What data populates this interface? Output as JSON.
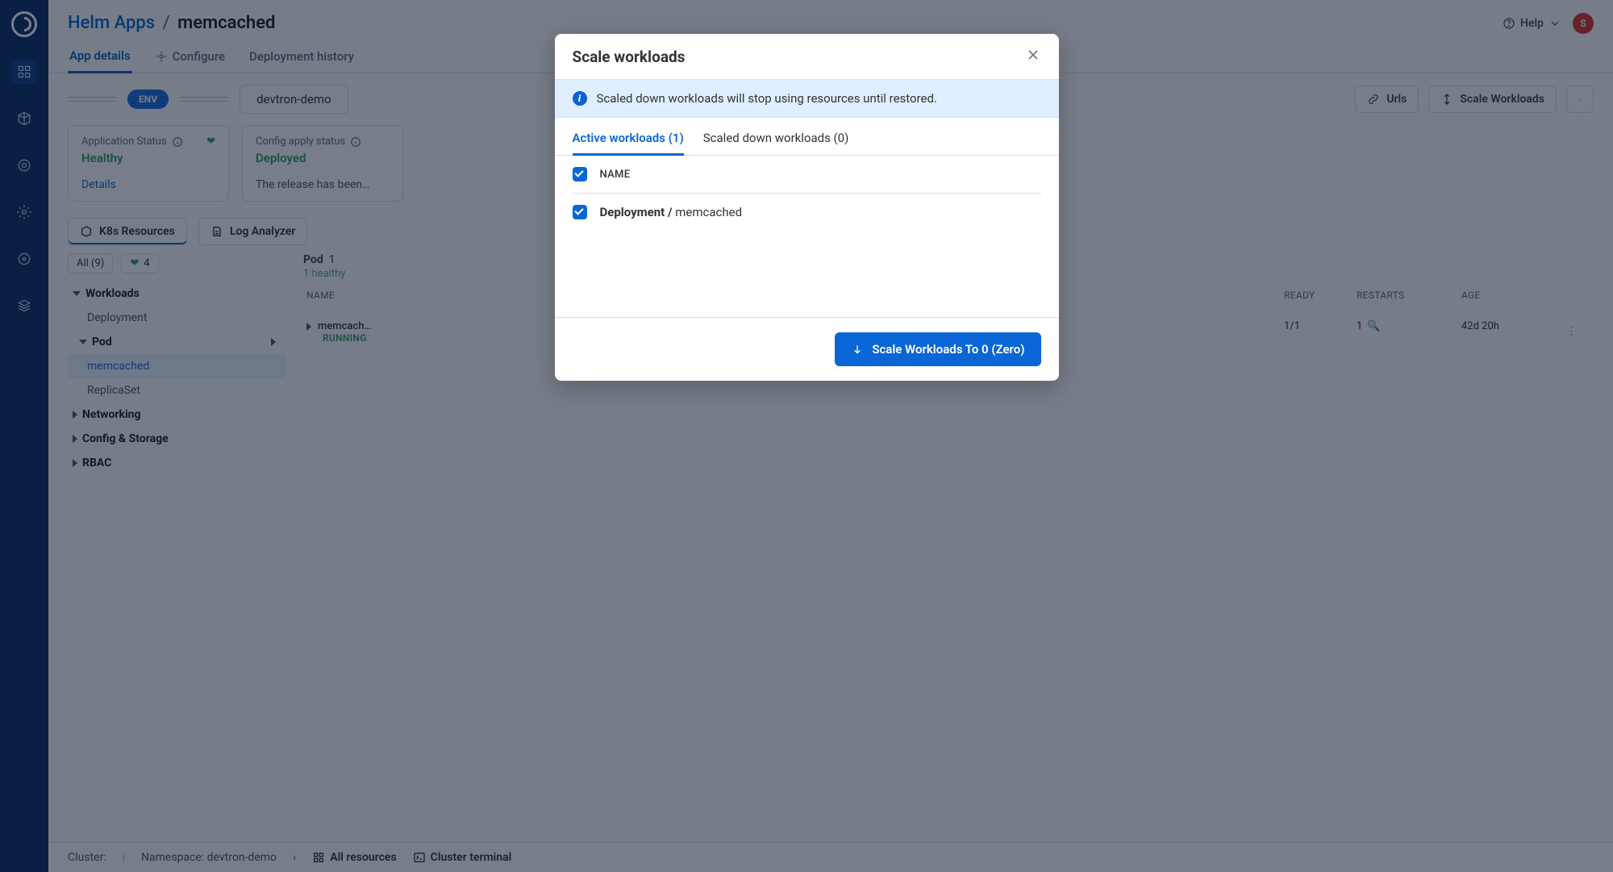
{
  "breadcrumb": {
    "parent": "Helm Apps",
    "current": "memcached"
  },
  "header": {
    "help": "Help",
    "avatar_initial": "S"
  },
  "tabs": {
    "app_details": "App details",
    "configure": "Configure",
    "deployment_history": "Deployment history"
  },
  "env": {
    "chip": "ENV",
    "name": "devtron-demo",
    "urls_btn": "Urls",
    "scale_btn": "Scale Workloads"
  },
  "status_card": {
    "label": "Application Status",
    "value": "Healthy",
    "details": "Details"
  },
  "config_card": {
    "label": "Config apply status",
    "value": "Deployed",
    "note": "The release has been…"
  },
  "rs_bar": {
    "k8s": "K8s Resources",
    "log": "Log Analyzer"
  },
  "tree": {
    "all": "All (9)",
    "health_count": "4",
    "workloads": "Workloads",
    "deployment": "Deployment",
    "pod": "Pod",
    "memcached": "memcached",
    "replicaset": "ReplicaSet",
    "networking": "Networking",
    "config_storage": "Config & Storage",
    "rbac": "RBAC"
  },
  "grid": {
    "title_kind": "Pod",
    "title_count": "1",
    "subtitle": "1 healthy",
    "col_name": "NAME",
    "col_ready": "READY",
    "col_restarts": "RESTARTS",
    "col_age": "AGE",
    "row": {
      "name": "memcach…",
      "status": "RUNNING",
      "ready": "1/1",
      "restarts": "1",
      "age": "42d 20h"
    }
  },
  "footer": {
    "cluster_label": "Cluster:",
    "namespace": "Namespace: devtron-demo",
    "all_resources": "All resources",
    "cluster_terminal": "Cluster terminal"
  },
  "modal": {
    "title": "Scale workloads",
    "info": "Scaled down workloads will stop using resources until restored.",
    "tab_active": "Active workloads (1)",
    "tab_scaled": "Scaled down workloads (0)",
    "col_name": "NAME",
    "row_kind": "Deployment /",
    "row_name": "memcached",
    "primary_btn": "Scale Workloads To 0 (Zero)"
  }
}
